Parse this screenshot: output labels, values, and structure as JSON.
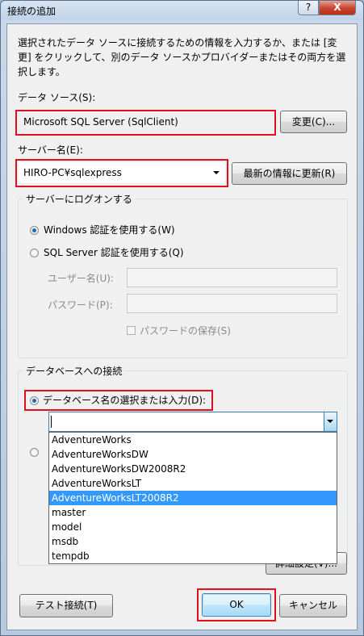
{
  "window": {
    "title": "接続の追加",
    "help_glyph": "?",
    "close_glyph": "X"
  },
  "intro_text": "選択されたデータ ソースに接続するための情報を入力するか、または [変更] をクリックして、別のデータ ソースかプロバイダーまたはその両方を選択します。",
  "data_source": {
    "label": "データ ソース(S):",
    "value": "Microsoft SQL Server (SqlClient)",
    "change_button": "変更(C)..."
  },
  "server": {
    "label": "サーバー名(E):",
    "value": "HIRO-PC¥sqlexpress",
    "refresh_button": "最新の情報に更新(R)"
  },
  "logon": {
    "caption": "サーバーにログオンする",
    "windows_auth": "Windows 認証を使用する(W)",
    "sql_auth": "SQL Server 認証を使用する(Q)",
    "selected": "windows",
    "username_label": "ユーザー名(U):",
    "password_label": "パスワード(P):",
    "save_password": "パスワードの保存(S)"
  },
  "database": {
    "caption": "データベースへの接続",
    "select_db_label": "データベース名の選択または入力(D):",
    "selected_option": "select",
    "db_name_value": "",
    "dropdown_items": [
      "AdventureWorks",
      "AdventureWorksDW",
      "AdventureWorksDW2008R2",
      "AdventureWorksLT",
      "AdventureWorksLT2008R2",
      "master",
      "model",
      "msdb",
      "tempdb"
    ],
    "highlighted_index": 4,
    "advanced_button": "詳細設定(V)..."
  },
  "footer": {
    "test_button": "テスト接続(T)",
    "ok_button": "OK",
    "cancel_button": "キャンセル"
  },
  "colors": {
    "highlight_box": "#e0101c",
    "selection": "#3399ff"
  }
}
